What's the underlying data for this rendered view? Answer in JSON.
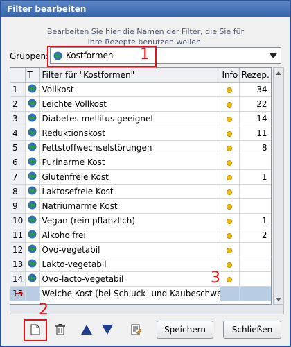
{
  "window": {
    "title": "Filter bearbeiten"
  },
  "description": {
    "line1": "Bearbeiten Sie hier die Namen der Filter, die Sie für",
    "line2": "Ihre Rezepte benutzen wollen."
  },
  "groups": {
    "label": "Gruppen:",
    "selected": "Kostformen",
    "icon": "globe-icon"
  },
  "table": {
    "headers": {
      "num": "",
      "type": "T",
      "filter": "Filter für \"Kostformen\"",
      "info": "Info",
      "recipes": "Rezep."
    },
    "rows": [
      {
        "num": "1",
        "name": "Vollkost",
        "count": "34"
      },
      {
        "num": "2",
        "name": "Leichte Vollkost",
        "count": "22"
      },
      {
        "num": "3",
        "name": "Diabetes mellitus geeignet",
        "count": "14"
      },
      {
        "num": "4",
        "name": "Reduktionskost",
        "count": "11"
      },
      {
        "num": "5",
        "name": "Fettstoffwechselstörungen",
        "count": "8"
      },
      {
        "num": "6",
        "name": "Purinarme Kost",
        "count": ""
      },
      {
        "num": "7",
        "name": "Glutenfreie Kost",
        "count": "1"
      },
      {
        "num": "8",
        "name": "Laktosefreie Kost",
        "count": ""
      },
      {
        "num": "9",
        "name": "Natriumarme Kost",
        "count": ""
      },
      {
        "num": "10",
        "name": "Vegan (rein pflanzlich)",
        "count": "1"
      },
      {
        "num": "11",
        "name": "Alkoholfrei",
        "count": "2"
      },
      {
        "num": "12",
        "name": "Ovo-vegetabil",
        "count": ""
      },
      {
        "num": "13",
        "name": "Lakto-vegetabil",
        "count": ""
      },
      {
        "num": "14",
        "name": "Ovo-lacto-vegetabil",
        "count": ""
      }
    ],
    "editing_row": {
      "num": "15",
      "value": "Weiche Kost (bei Schluck- und Kaubeschwerden)"
    }
  },
  "buttons": {
    "save": "Speichern",
    "close": "Schließen"
  },
  "annotations": {
    "marker1": "1",
    "marker2": "2",
    "marker3": "3"
  },
  "colors": {
    "title_bar": "#3566ad",
    "annotation_red": "#e0161c",
    "selection": "#b8cce4"
  }
}
